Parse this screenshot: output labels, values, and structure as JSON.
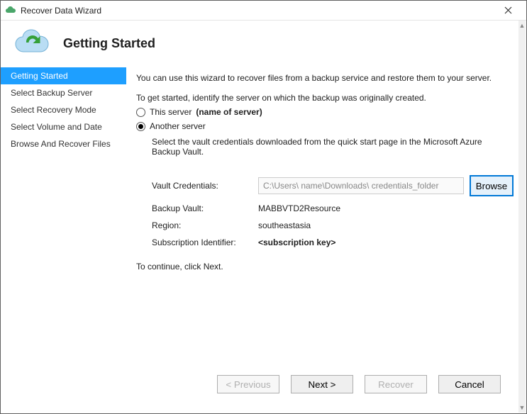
{
  "window": {
    "title": "Recover Data Wizard"
  },
  "header": {
    "title": "Getting Started"
  },
  "sidebar": {
    "items": [
      {
        "label": "Getting Started",
        "active": true
      },
      {
        "label": "Select Backup Server",
        "active": false
      },
      {
        "label": "Select Recovery Mode",
        "active": false
      },
      {
        "label": "Select Volume and Date",
        "active": false
      },
      {
        "label": "Browse And Recover Files",
        "active": false
      }
    ]
  },
  "content": {
    "intro_line1": "You can use this wizard to recover files from a backup service and restore them to your server.",
    "intro_line2": "To get started, identify the server on which the backup was originally created.",
    "radio_this": "This server",
    "radio_this_suffix": "(name of server)",
    "radio_another": "Another server",
    "radio_selected": "another",
    "vault_note": "Select the vault credentials downloaded from the quick start page in the Microsoft Azure Backup Vault.",
    "vault_credentials_label": "Vault Credentials:",
    "vault_credentials_value": "C:\\Users\\ name\\Downloads\\ credentials_folder",
    "browse_label": "Browse",
    "backup_vault_label": "Backup Vault:",
    "backup_vault_value": "MABBVTD2Resource",
    "region_label": "Region:",
    "region_value": "southeastasia",
    "subscription_label": "Subscription Identifier:",
    "subscription_value": "<subscription key>",
    "continue_text": "To continue, click Next."
  },
  "footer": {
    "previous": "< Previous",
    "next": "Next >",
    "recover": "Recover",
    "cancel": "Cancel"
  }
}
